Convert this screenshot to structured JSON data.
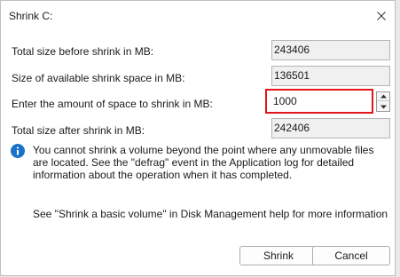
{
  "dialog": {
    "title": "Shrink C:"
  },
  "rows": [
    {
      "label": "Total size before shrink in MB:",
      "value": "243406"
    },
    {
      "label": "Size of available shrink space in MB:",
      "value": "136501"
    },
    {
      "label": "Enter the amount of space to shrink in MB:",
      "value": "1000"
    },
    {
      "label": "Total size after shrink in MB:",
      "value": "242406"
    }
  ],
  "info": {
    "icon": "info-icon",
    "text": "You cannot shrink a volume beyond the point where any unmovable files are located. See the \"defrag\" event in the Application log for detailed information about the operation when it has completed."
  },
  "help": {
    "text": "See \"Shrink a basic volume\" in Disk Management help for more information"
  },
  "buttons": {
    "shrink": "Shrink",
    "cancel": "Cancel"
  },
  "colors": {
    "highlight": "#e0161b",
    "info_blue": "#1a73c8"
  }
}
